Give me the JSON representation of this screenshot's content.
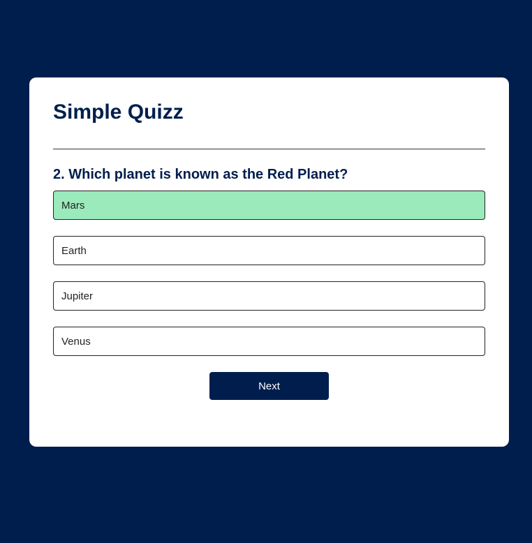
{
  "app": {
    "title": "Simple Quizz"
  },
  "quiz": {
    "question": "2. Which planet is known as the Red Planet?",
    "answers": [
      {
        "label": "Mars",
        "state": "correct"
      },
      {
        "label": "Earth",
        "state": "default"
      },
      {
        "label": "Jupiter",
        "state": "default"
      },
      {
        "label": "Venus",
        "state": "default"
      }
    ],
    "next_label": "Next"
  },
  "colors": {
    "background": "#001e4d",
    "card": "#ffffff",
    "accent": "#001e4d",
    "correct": "#9aeabc"
  }
}
